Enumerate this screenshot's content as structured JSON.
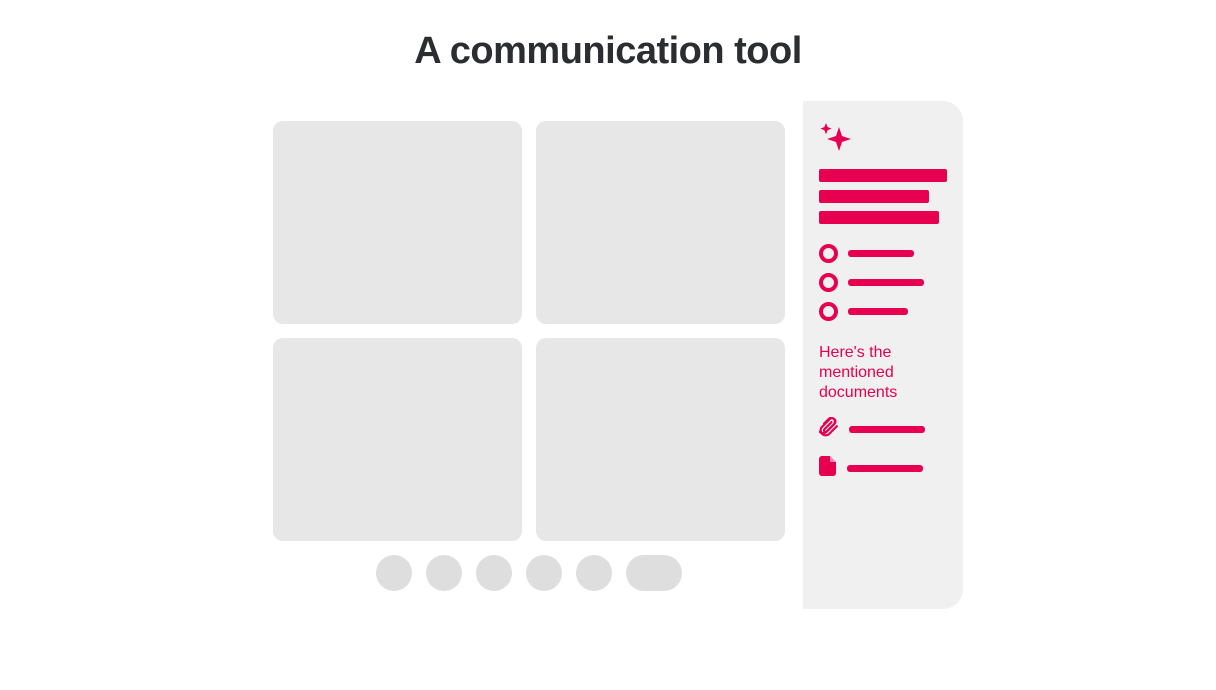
{
  "page": {
    "title": "A communication tool"
  },
  "colors": {
    "accent": "#e6004f",
    "panel": "#f0f0f0",
    "tile": "#e7e7e7",
    "control": "#dedede",
    "text": "#2b2d30"
  },
  "main": {
    "tiles": 4,
    "controls": {
      "circles": 5,
      "pill": 1
    }
  },
  "sidebar": {
    "header_bars": [
      128,
      110,
      120
    ],
    "radio_items": [
      66,
      76,
      60
    ],
    "docs_label": "Here's the mentioned documents",
    "attachments": [
      {
        "icon": "paperclip",
        "width": 76
      },
      {
        "icon": "file",
        "width": 76
      }
    ]
  }
}
